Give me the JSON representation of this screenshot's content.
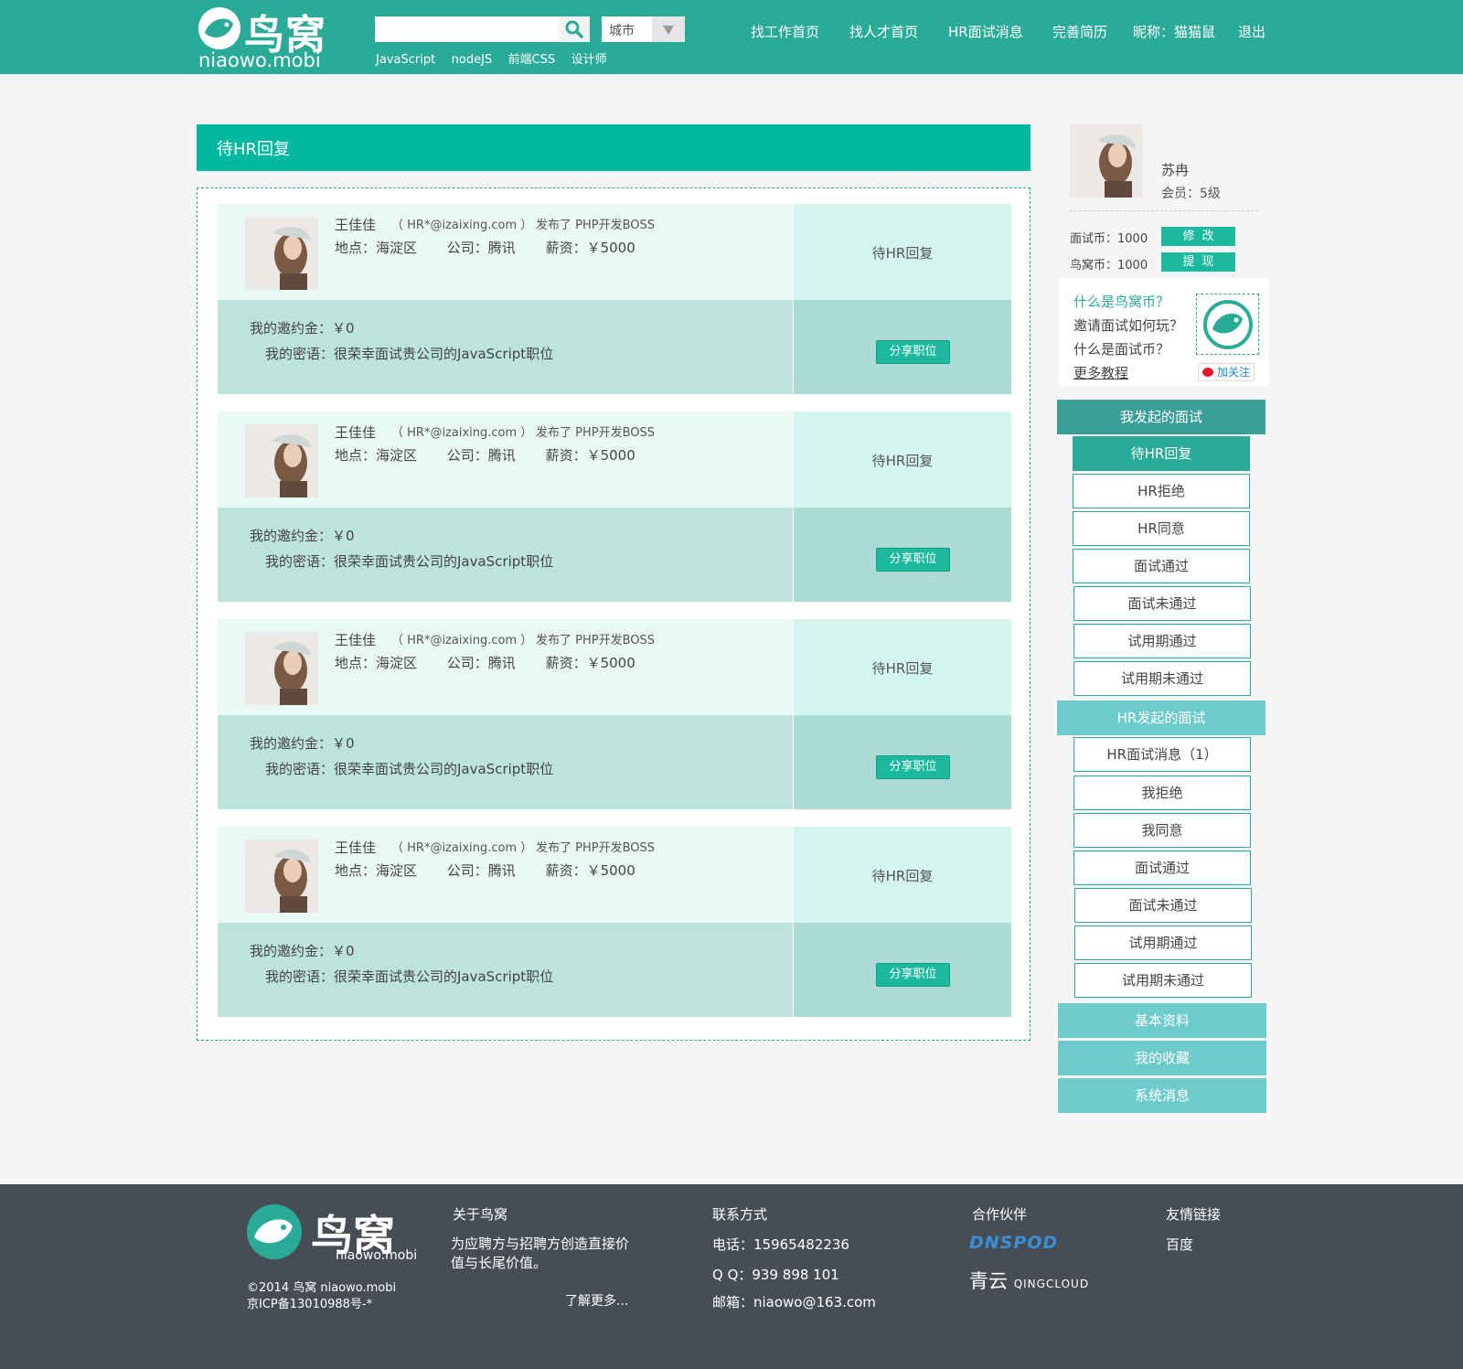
{
  "header": {
    "logo_cn": "鸟窝",
    "logo_en": "niaowo.mobi",
    "search_placeholder": "",
    "city_label": "城市",
    "tags": [
      "JavaScript",
      "nodeJS",
      "前端CSS",
      "设计师"
    ],
    "nav": [
      "找工作首页",
      "找人才首页",
      "HR面试消息",
      "完善简历",
      "昵称：猫猫鼠",
      "退出"
    ]
  },
  "main": {
    "title": "待HR回复",
    "cards": [
      {
        "name": "王佳佳",
        "email": "（ HR*@izaixing.com ）",
        "published": "发布了  PHP开发BOSS",
        "location": "地点：海淀区",
        "company": "公司：腾讯",
        "salary": "薪资：￥5000",
        "status": "待HR回复",
        "deposit": "我的邀约金：￥0",
        "word": "我的密语：很荣幸面试贵公司的JavaScript职位",
        "share": "分享职位"
      },
      {
        "name": "王佳佳",
        "email": "（ HR*@izaixing.com ）",
        "published": "发布了  PHP开发BOSS",
        "location": "地点：海淀区",
        "company": "公司：腾讯",
        "salary": "薪资：￥5000",
        "status": "待HR回复",
        "deposit": "我的邀约金：￥0",
        "word": "我的密语：很荣幸面试贵公司的JavaScript职位",
        "share": "分享职位"
      },
      {
        "name": "王佳佳",
        "email": "（ HR*@izaixing.com ）",
        "published": "发布了  PHP开发BOSS",
        "location": "地点：海淀区",
        "company": "公司：腾讯",
        "salary": "薪资：￥5000",
        "status": "待HR回复",
        "deposit": "我的邀约金：￥0",
        "word": "我的密语：很荣幸面试贵公司的JavaScript职位",
        "share": "分享职位"
      },
      {
        "name": "王佳佳",
        "email": "（ HR*@izaixing.com ）",
        "published": "发布了  PHP开发BOSS",
        "location": "地点：海淀区",
        "company": "公司：腾讯",
        "salary": "薪资：￥5000",
        "status": "待HR回复",
        "deposit": "我的邀约金：￥0",
        "word": "我的密语：很荣幸面试贵公司的JavaScript职位",
        "share": "分享职位"
      }
    ]
  },
  "sidebar": {
    "user_name": "苏冉",
    "user_level": "会员：5级",
    "interview_coin": "面试币：1000",
    "interview_coin_btn": "修改",
    "niaowo_coin": "鸟窝币：1000",
    "niaowo_coin_btn": "提现",
    "faq": [
      "什么是鸟窝币？",
      "邀请面试如何玩？",
      "什么是面试币？",
      "更多教程"
    ],
    "follow": "加关注",
    "section1": "我发起的面试",
    "section1_items": [
      "待HR回复",
      "HR拒绝",
      "HR同意",
      "面试通过",
      "面试未通过",
      "试用期通过",
      "试用期未通过"
    ],
    "section2": "HR发起的面试",
    "section2_items": [
      "HR面试消息（1）",
      "我拒绝",
      "我同意",
      "面试通过",
      "面试未通过",
      "试用期通过",
      "试用期未通过"
    ],
    "extra": [
      "基本资料",
      "我的收藏",
      "系统消息"
    ]
  },
  "footer": {
    "logo_cn": "鸟窝",
    "logo_en": "niaowo.mobi",
    "copyright": "©2014 鸟窝 niaowo.mobi",
    "icp": "京ICP备13010988号-*",
    "about_title": "关于鸟窝",
    "about_text": "为应聘方与招聘方创造直接价值与长尾价值。",
    "about_more": "了解更多...",
    "contact_title": "联系方式",
    "phone": "电话：15965482236",
    "qq": "Q Q：939 898 101",
    "email": "邮箱：niaowo@163.com",
    "partner_title": "合作伙伴",
    "partner_dnspod": "DNSPOD",
    "partner_qing_cn": "青云",
    "partner_qing_en": "QINGCLOUD",
    "links_title": "友情链接",
    "links_baidu": "百度"
  },
  "colors": {
    "brand": "#2aab98",
    "title_bar": "#00b8a0",
    "footer_bg": "#474d54"
  }
}
